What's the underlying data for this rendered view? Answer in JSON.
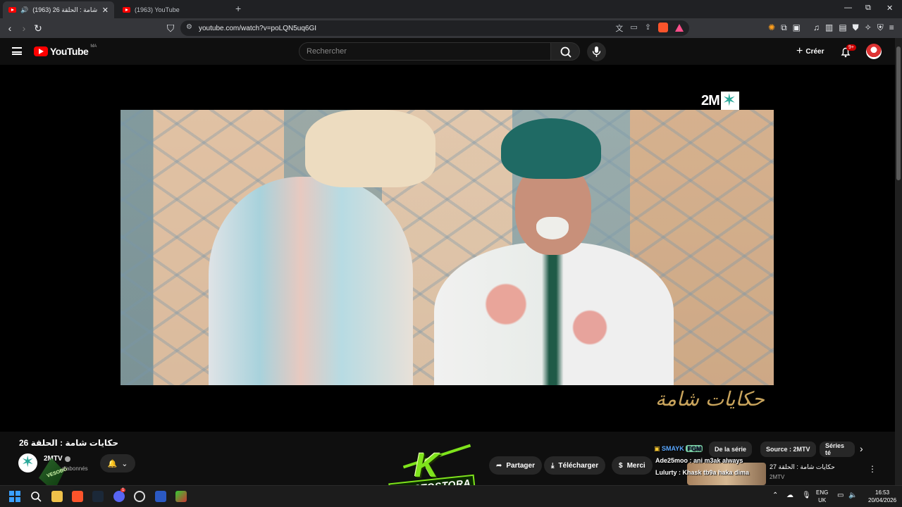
{
  "browser": {
    "tabs": [
      {
        "title": "(1963) حكايات شامة : الحلقة 26",
        "active": true,
        "audio": true
      },
      {
        "title": "(1963) YouTube",
        "active": false
      }
    ],
    "new_tab": "+",
    "window_controls": {
      "minimize": "—",
      "restore": "⧉",
      "close": "✕"
    },
    "url": "youtube.com/watch?v=poLQN5uq6GI"
  },
  "youtube": {
    "logo_text": "YouTube",
    "country_code": "MA",
    "search_placeholder": "Rechercher",
    "create_label": "Créer",
    "notification_count": "9+"
  },
  "video": {
    "channel_logo": "2M",
    "show_logo": "حكايات شامة",
    "title": "حكايات شامة : الحلقة 26",
    "channel": "2MTV",
    "subscribers": "d'abonnés",
    "actions": {
      "share": "Partager",
      "download": "Télécharger",
      "thanks": "Merci"
    }
  },
  "chips": [
    {
      "label": "De la série"
    },
    {
      "label": "Source : 2MTV"
    },
    {
      "label": "Séries té"
    }
  ],
  "recommendation": {
    "title": "حكايات شامة : الحلقة 27",
    "channel": "2MTV"
  },
  "chat": [
    {
      "user": "SMAYK",
      "badge": "FGM"
    },
    {
      "user": "Ade25moo",
      "message": "ani m3ak always"
    },
    {
      "user": "Lulurty",
      "message": "Khask tb9a haka dima"
    }
  ],
  "stream_overlay": {
    "letter": "K",
    "name": "AVASTOSTORA",
    "tag": "VESOBO"
  },
  "taskbar": {
    "lang_top": "ENG",
    "lang_bottom": "UK",
    "time": "16:53",
    "date": "20/04/2026",
    "discord_badge": "1"
  }
}
